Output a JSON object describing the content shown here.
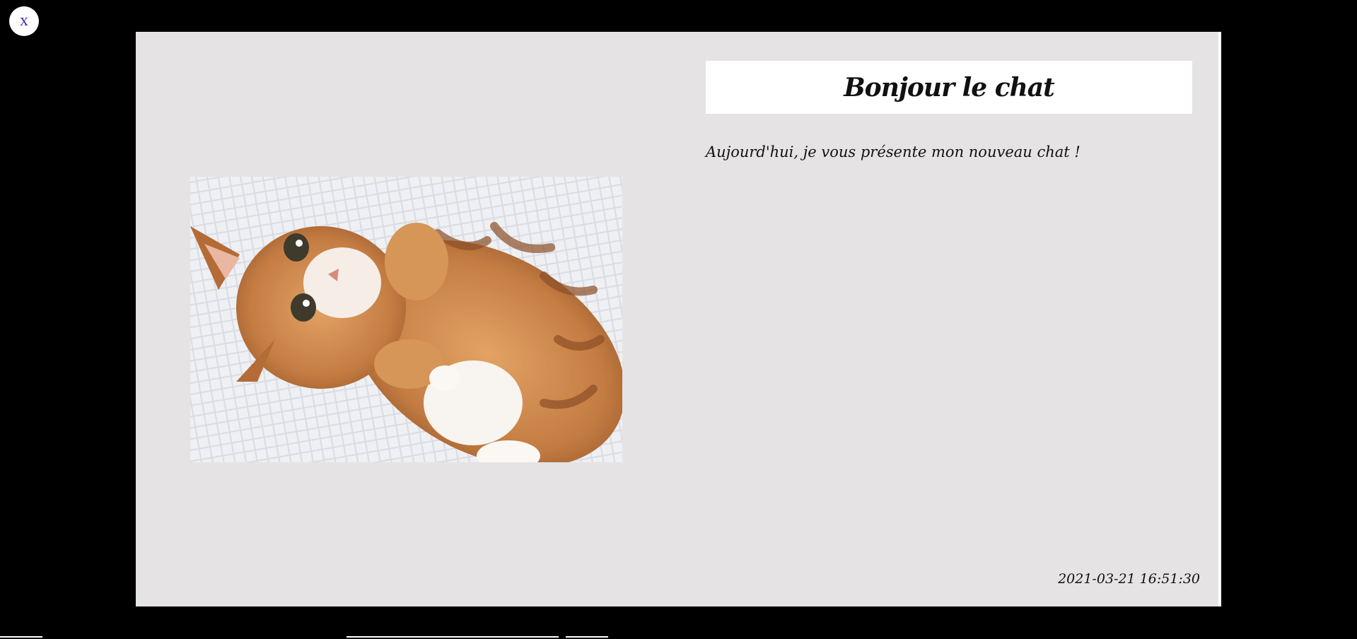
{
  "close_button": {
    "label": "x",
    "icon": "close-icon"
  },
  "post": {
    "title": "Bonjour le chat",
    "text": "Aujourd'hui, je vous présente mon nouveau chat !",
    "timestamp": "2021-03-21 16:51:30",
    "image": {
      "subject": "kitten-photo",
      "colors": {
        "fur": "#c9844a",
        "blanket": "#eef0f3"
      }
    }
  },
  "colors": {
    "backdrop": "#000000",
    "card_background": "#e5e3e4",
    "title_background": "#ffffff",
    "close_icon": "#4a2bb0"
  }
}
